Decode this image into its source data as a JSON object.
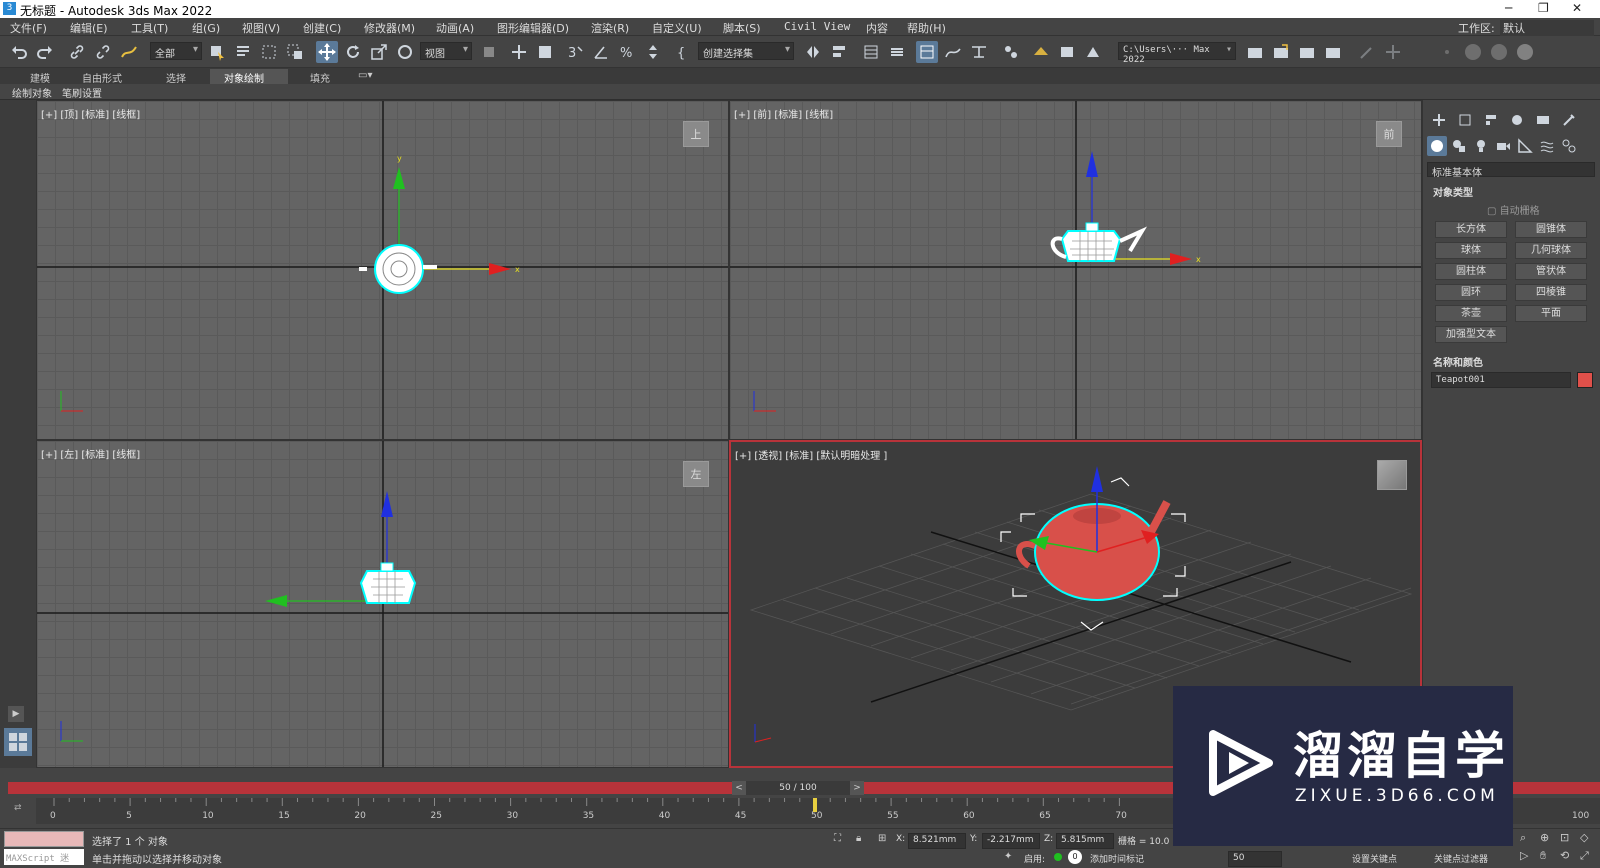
{
  "window": {
    "title": "无标题 - Autodesk 3ds Max 2022",
    "controls": [
      "─",
      "❐",
      "✕"
    ]
  },
  "menu": [
    "文件(F)",
    "编辑(E)",
    "工具(T)",
    "组(G)",
    "视图(V)",
    "创建(C)",
    "修改器(M)",
    "动画(A)",
    "图形编辑器(D)",
    "渲染(R)",
    "自定义(U)",
    "脚本(S)",
    "Civil View",
    "内容",
    "帮助(H)"
  ],
  "workspace": {
    "label": "工作区:",
    "value": "默认"
  },
  "toolbar": {
    "filter": "全部",
    "ref_coord": "视图",
    "selection_set": "创建选择集",
    "project_path": "C:\\Users\\··· Max 2022"
  },
  "ribbon": {
    "tabs": [
      "建模",
      "自由形式",
      "选择",
      "对象绘制",
      "填充"
    ],
    "active": "对象绘制",
    "sub": [
      "绘制对象",
      "笔刷设置"
    ]
  },
  "viewports": [
    {
      "label": "[+] [顶] [标准] [线框]",
      "cube": "上"
    },
    {
      "label": "[+] [前] [标准] [线框]",
      "cube": "前"
    },
    {
      "label": "[+] [左] [标准] [线框]",
      "cube": "左"
    },
    {
      "label": "[+] [透视] [标准] [默认明暗处理 ]",
      "cube": ""
    }
  ],
  "command_panel": {
    "category": "标准基本体",
    "section_object_type": "对象类型",
    "auto_grid": "自动栅格",
    "buttons": [
      "长方体",
      "圆锥体",
      "球体",
      "几何球体",
      "圆柱体",
      "管状体",
      "圆环",
      "四棱锥",
      "茶壶",
      "平面",
      "加强型文本"
    ],
    "section_name_color": "名称和颜色",
    "object_name": "Teapot001",
    "object_color": "#e0504a"
  },
  "timeline": {
    "frame_display": "50 / 100",
    "current_frame": 50,
    "total_frames": 100,
    "ticks": [
      "0",
      "5",
      "10",
      "15",
      "20",
      "25",
      "30",
      "35",
      "40",
      "45",
      "50",
      "55",
      "60",
      "65",
      "70",
      "100"
    ]
  },
  "status": {
    "selected": "选择了 1 个 对象",
    "hint": "单击并拖动以选择并移动对象",
    "maxscript": "MAXScript 迷",
    "x_label": "X:",
    "x": "8.521mm",
    "y_label": "Y:",
    "y": "-2.217mm",
    "z_label": "Z:",
    "z": "5.815mm",
    "grid": "栅格 = 10.0",
    "enable": "启用:",
    "add_time_tag": "添加时间标记",
    "frame_field": "50",
    "set_key": "设置关键点",
    "key_filter": "关键点过滤器"
  },
  "watermark": {
    "brand": "溜溜自学",
    "url": "ZIXUE.3D66.COM"
  },
  "colors": {
    "accent": "#5b7a99",
    "selection": "#00ffff",
    "x_axis": "#e02020",
    "y_axis": "#20c020",
    "z_axis": "#2030e0",
    "teapot": "#e0504a",
    "timeline_bar": "#b8333a"
  }
}
